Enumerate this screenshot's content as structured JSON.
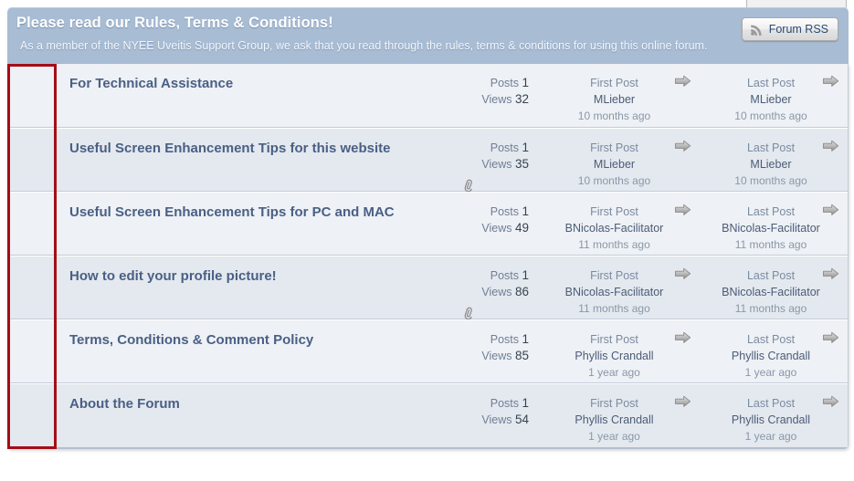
{
  "header": {
    "title": "Please read our Rules, Terms & Conditions!",
    "subtitle": "As a member of the NYEE Uveitis Support Group, we ask that you read through the rules, terms & conditions for using this online forum.",
    "background_color": "#a8bcd4",
    "title_color": "#ffffff"
  },
  "rss_button": {
    "label": "Forum RSS",
    "icon": "rss-icon",
    "text_color": "#2b4a72"
  },
  "labels": {
    "posts": "Posts",
    "views": "Views",
    "first_post": "First Post",
    "last_post": "Last Post",
    "goto_icon": "goto-arrow-icon",
    "attachment_icon": "paperclip-icon"
  },
  "annotation": {
    "color": "#a50d16",
    "shape": "rectangle"
  },
  "topics": [
    {
      "title": "For Technical Assistance",
      "posts": "1",
      "views": "32",
      "has_attachment": false,
      "first_post_author": "MLieber",
      "first_post_time": "10 months ago",
      "last_post_author": "MLieber",
      "last_post_time": "10 months ago"
    },
    {
      "title": "Useful Screen Enhancement Tips for this website",
      "posts": "1",
      "views": "35",
      "has_attachment": true,
      "first_post_author": "MLieber",
      "first_post_time": "10 months ago",
      "last_post_author": "MLieber",
      "last_post_time": "10 months ago"
    },
    {
      "title": "Useful Screen Enhancement Tips for PC and MAC",
      "posts": "1",
      "views": "49",
      "has_attachment": false,
      "first_post_author": "BNicolas-Facilitator",
      "first_post_time": "11 months ago",
      "last_post_author": "BNicolas-Facilitator",
      "last_post_time": "11 months ago"
    },
    {
      "title": "How to edit your profile picture!",
      "posts": "1",
      "views": "86",
      "has_attachment": true,
      "first_post_author": "BNicolas-Facilitator",
      "first_post_time": "11 months ago",
      "last_post_author": "BNicolas-Facilitator",
      "last_post_time": "11 months ago"
    },
    {
      "title": "Terms, Conditions & Comment Policy",
      "posts": "1",
      "views": "85",
      "has_attachment": false,
      "first_post_author": "Phyllis Crandall",
      "first_post_time": "1 year ago",
      "last_post_author": "Phyllis Crandall",
      "last_post_time": "1 year ago"
    },
    {
      "title": "About the Forum",
      "posts": "1",
      "views": "54",
      "has_attachment": false,
      "first_post_author": "Phyllis Crandall",
      "first_post_time": "1 year ago",
      "last_post_author": "Phyllis Crandall",
      "last_post_time": "1 year ago"
    }
  ]
}
